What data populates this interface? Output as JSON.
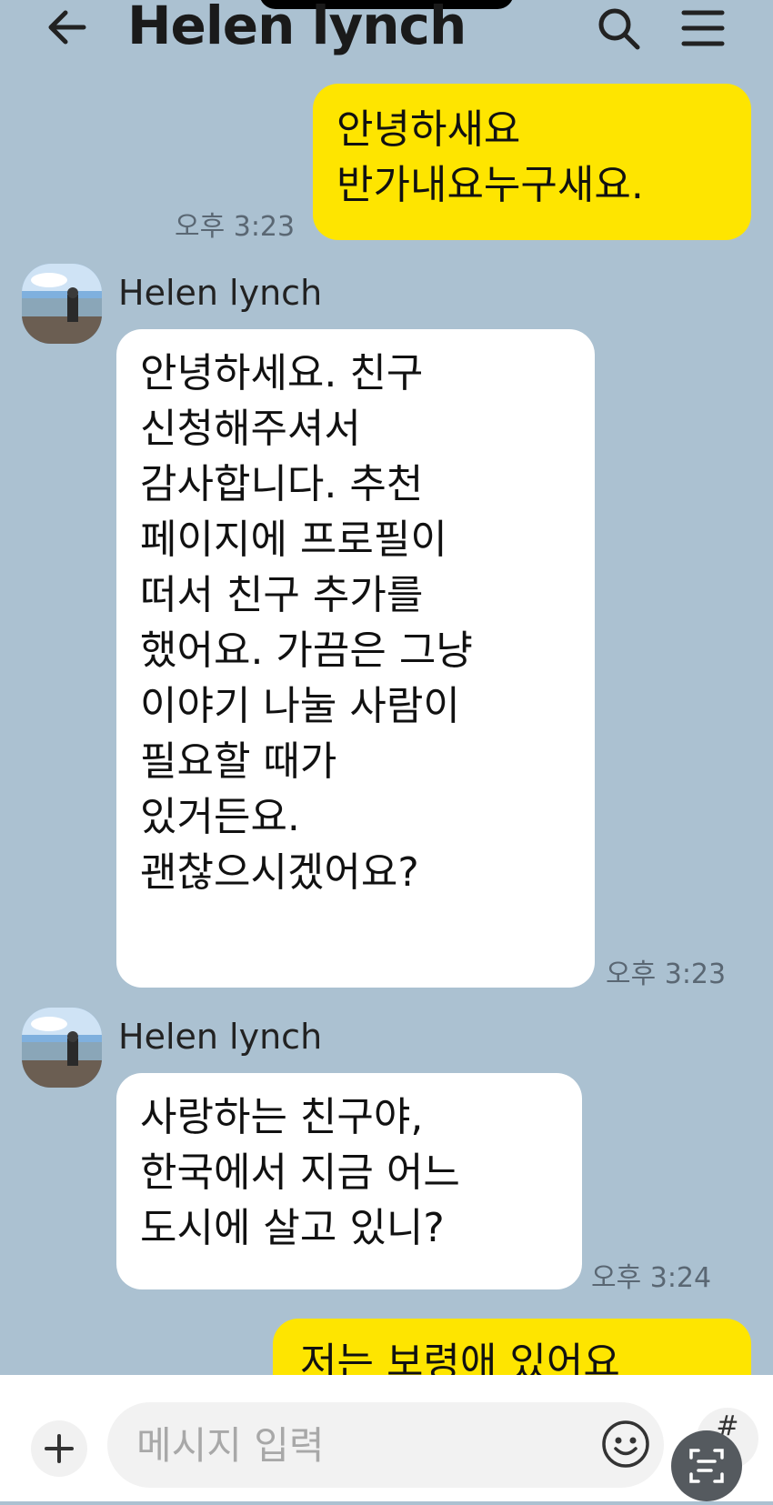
{
  "header": {
    "title": "Helen lynch",
    "back_icon": "arrow-left-icon",
    "search_icon": "search-icon",
    "menu_icon": "hamburger-menu-icon"
  },
  "messages": [
    {
      "from": "me",
      "lines": [
        "안녕하새요",
        "반가내요누구새요."
      ],
      "time": "오후 3:23"
    },
    {
      "from": "them",
      "sender": "Helen lynch",
      "lines": [
        "안녕하세요. 친구",
        "신청해주셔서",
        "감사합니다. 추천",
        "페이지에 프로필이",
        "떠서 친구 추가를",
        "했어요. 가끔은 그냥",
        "이야기 나눌 사람이",
        "필요할 때가",
        "있거든요.",
        "괜찮으시겠어요?"
      ],
      "time": "오후 3:23"
    },
    {
      "from": "them",
      "sender": "Helen lynch",
      "lines": [
        "사랑하는 친구야,",
        "한국에서 지금 어느",
        "도시에 살고 있니?"
      ],
      "time": "오후 3:24"
    },
    {
      "from": "me",
      "lines": [
        "저는 보령애 있어요"
      ],
      "time": ""
    }
  ],
  "composer": {
    "placeholder": "메시지 입력",
    "value": "",
    "add_icon": "plus-icon",
    "emoji_icon": "emoji-icon",
    "hash_icon": "hash-icon",
    "scan_icon": "scan-text-icon"
  },
  "colors": {
    "background": "#abc1d1",
    "my_bubble": "#fee500",
    "their_bubble": "#ffffff"
  }
}
